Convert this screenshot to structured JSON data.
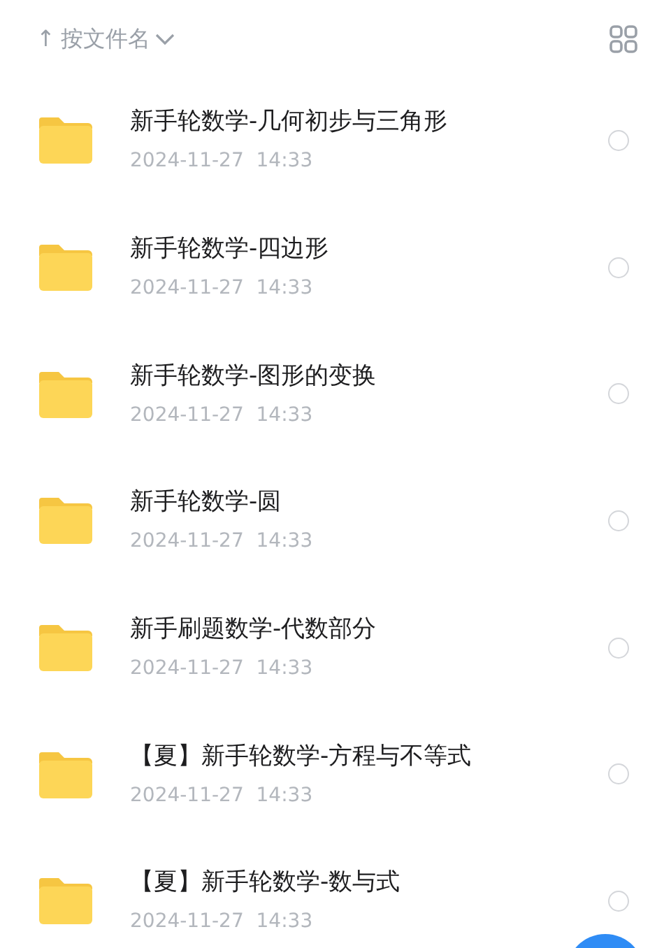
{
  "sort": {
    "arrow": "↑",
    "label": "按文件名"
  },
  "files": [
    {
      "name": "新手轮数学-几何初步与三角形",
      "date": "2024-11-27  14:33",
      "selected": false
    },
    {
      "name": "新手轮数学-四边形",
      "date": "2024-11-27  14:33",
      "selected": false
    },
    {
      "name": "新手轮数学-图形的变换",
      "date": "2024-11-27  14:33",
      "selected": false
    },
    {
      "name": "新手轮数学-圆",
      "date": "2024-11-27  14:33",
      "selected": false
    },
    {
      "name": "新手刷题数学-代数部分",
      "date": "2024-11-27  14:33",
      "selected": false
    },
    {
      "name": "【夏】新手轮数学-方程与不等式",
      "date": "2024-11-27  14:33",
      "selected": false
    },
    {
      "name": "【夏】新手轮数学-数与式",
      "date": "2024-11-27  14:33",
      "selected": false
    }
  ]
}
